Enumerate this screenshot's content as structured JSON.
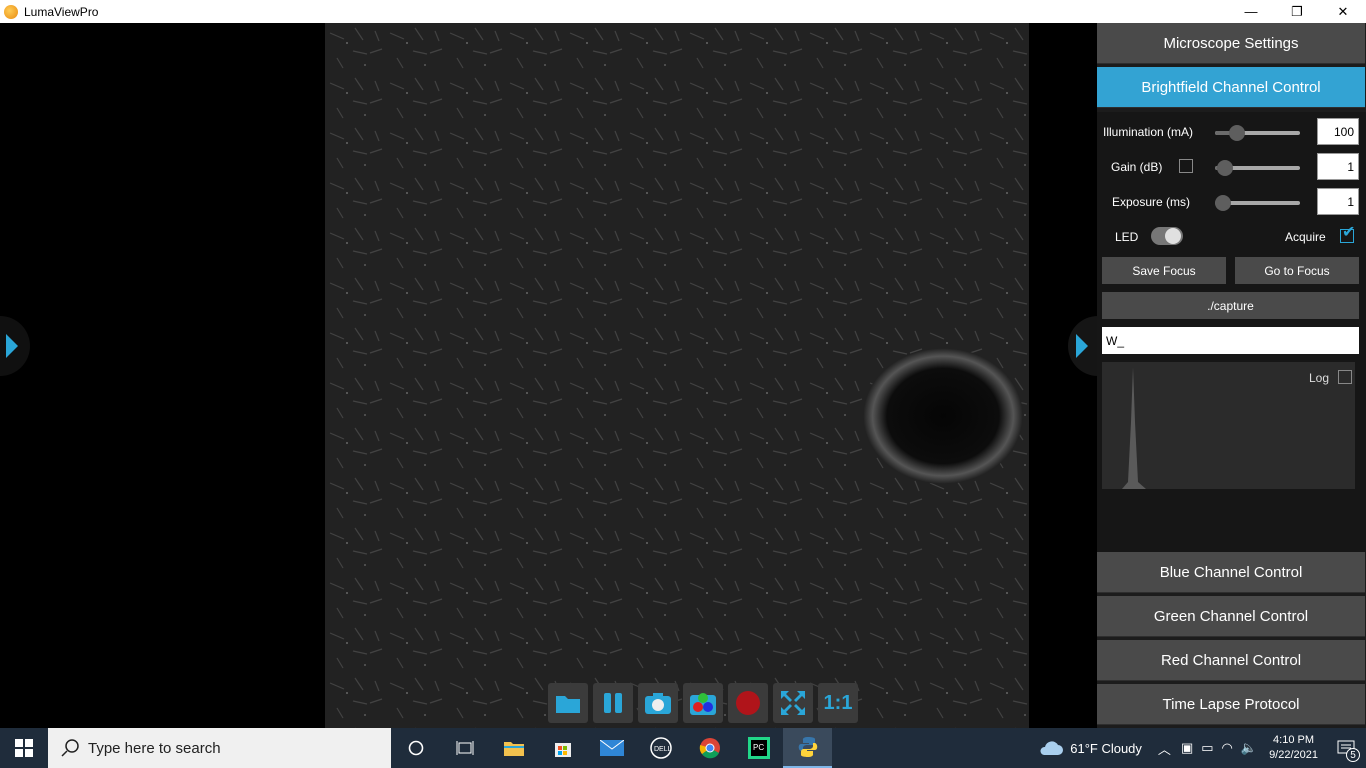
{
  "window": {
    "title": "LumaViewPro",
    "minimize": "—",
    "restore": "❐",
    "close": "✕"
  },
  "toolbar": {
    "buttons": [
      "folder-icon",
      "pause-icon",
      "camera-icon",
      "composite-icon",
      "record-icon",
      "fit-icon",
      "one-to-one-icon"
    ],
    "one_to_one_label": "1:1"
  },
  "panel": {
    "microscope_settings": "Microscope Settings",
    "brightfield_control": "Brightfield Channel Control",
    "illumination_label": "Illumination (mA)",
    "illumination_value": "100",
    "illumination_level": 0.2,
    "gain_label": "Gain (dB)",
    "gain_value": "1",
    "gain_level": 0.03,
    "exposure_label": "Exposure (ms)",
    "exposure_value": "1",
    "exposure_level": 0.0,
    "led_label": "LED",
    "led_on": true,
    "acquire_label": "Acquire",
    "acquire_checked": true,
    "save_focus": "Save Focus",
    "go_to_focus": "Go to Focus",
    "capture_path": "./capture",
    "filename_prefix": "W_",
    "log_label": "Log",
    "log_checked": false,
    "blue_control": "Blue Channel Control",
    "green_control": "Green Channel Control",
    "red_control": "Red Channel Control",
    "time_lapse": "Time Lapse Protocol"
  },
  "taskbar": {
    "search_placeholder": "Type here to search",
    "weather": "61°F  Cloudy",
    "time": "4:10 PM",
    "date": "9/22/2021",
    "notifications": "5"
  },
  "colors": {
    "accent": "#33a3d3",
    "panel_button": "#4a4a4a",
    "taskbar": "#1f2c3b"
  }
}
